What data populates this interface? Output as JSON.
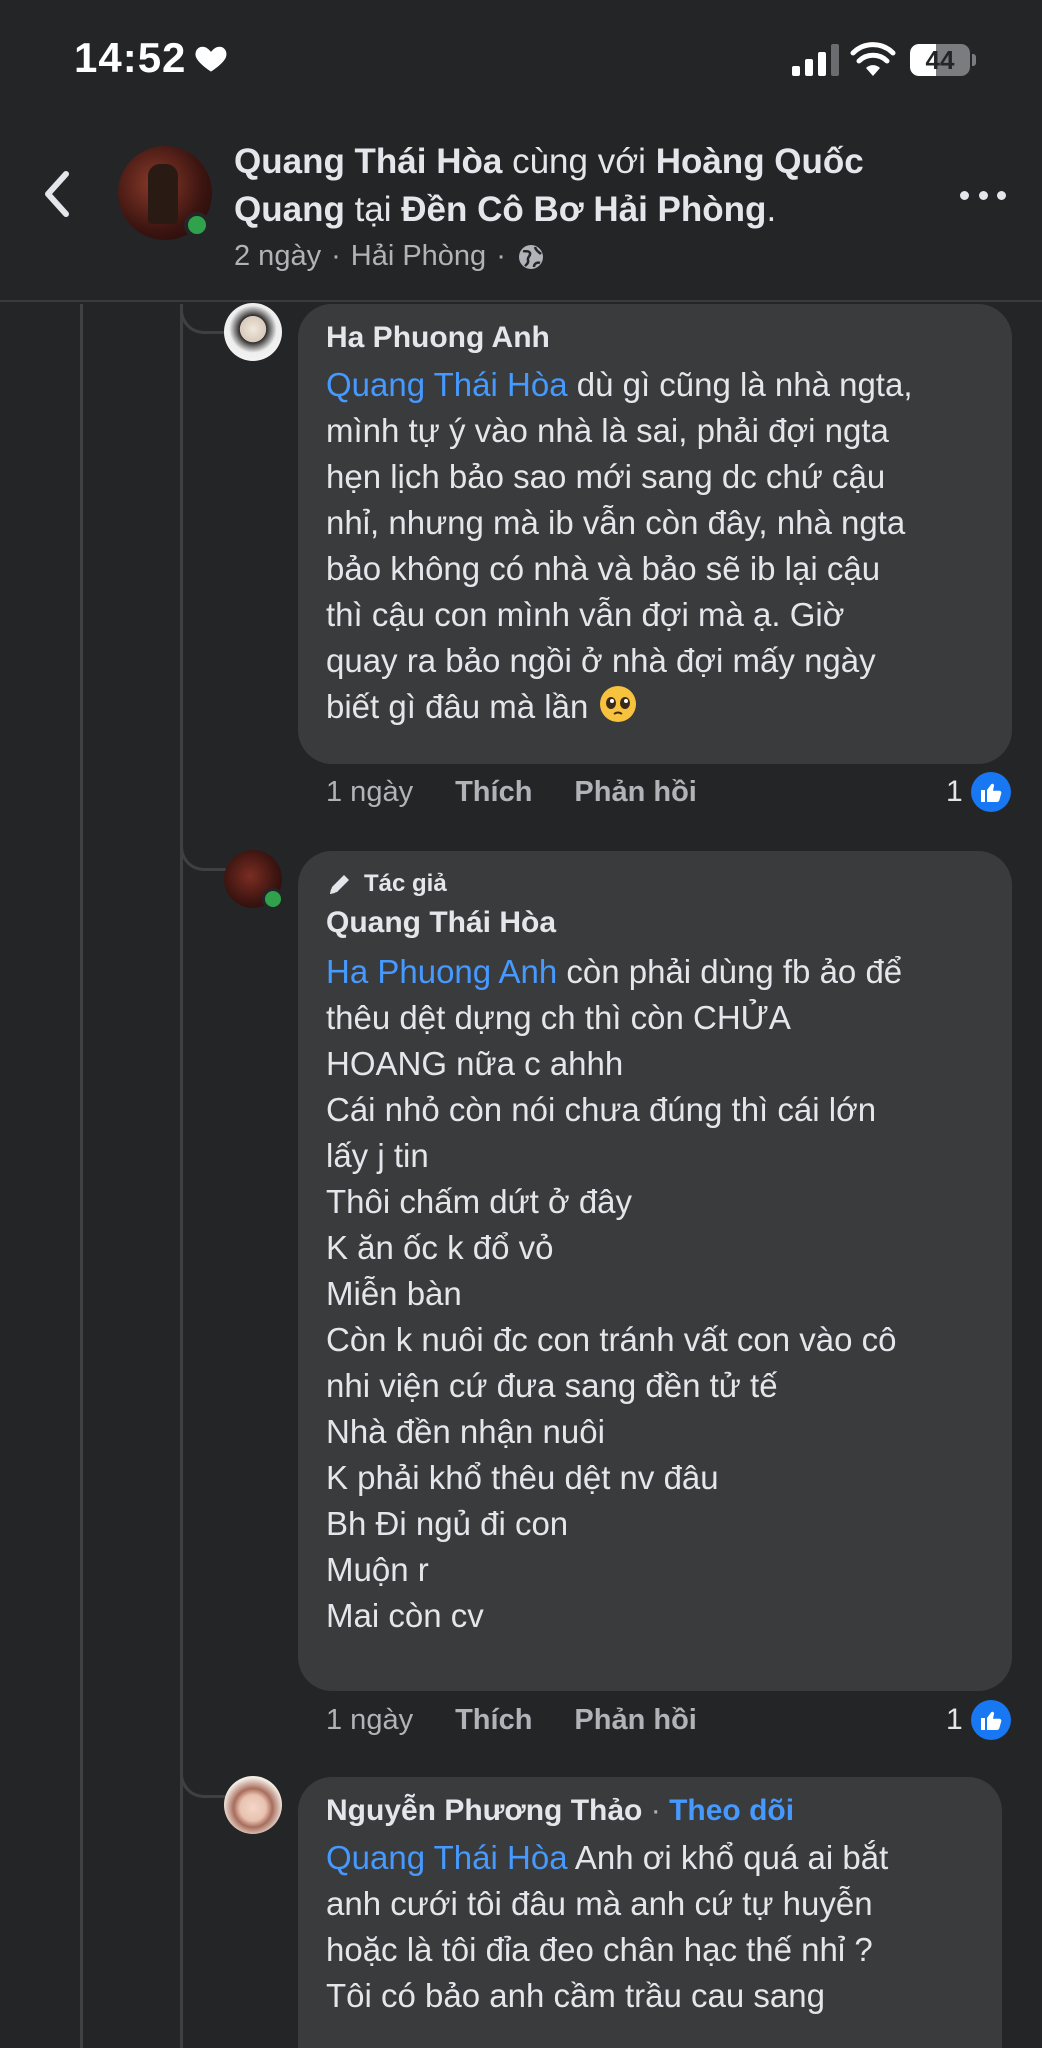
{
  "status_bar": {
    "time": "14:52",
    "battery": "44",
    "battery_level": 0.44,
    "icons": [
      "heart-icon",
      "signal-icon",
      "wifi-icon",
      "battery-icon"
    ]
  },
  "header": {
    "author": "Quang Thái Hòa",
    "with_text": "cùng với",
    "tagged": "Hoàng Quốc Quang",
    "at_text": "tại",
    "place": "Đền Cô Bơ Hải Phòng",
    "period": ".",
    "time_ago": "2 ngày",
    "separator": "·",
    "location": "Hải Phòng",
    "separator2": "·"
  },
  "comments": [
    {
      "author": "Ha Phuong Anh",
      "mention": "Quang Thái Hòa",
      "text": " dù gì cũng là nhà ngta,\nmình tự ý vào nhà là sai, phải đợi ngta\nhẹn lịch bảo sao mới sang dc chứ cậu\nnhỉ, nhưng mà ib vẫn còn đây, nhà ngta\nbảo không có nhà và bảo sẽ ib lại cậu\nthì cậu con mình vẫn đợi mà ạ. Giờ\nquay ra bảo ngồi ở nhà đợi mấy ngày\nbiết gì đâu mà lần ",
      "time_ago": "1 ngày",
      "like_label": "Thích",
      "reply_label": "Phản hồi",
      "reaction_count": "1"
    },
    {
      "badge": "Tác giả",
      "author": "Quang Thái Hòa",
      "mention": "Ha Phuong Anh",
      "text": " còn phải dùng fb ảo để\nthêu dệt dựng ch thì còn CHỬA\nHOANG nữa c ahhh\nCái nhỏ còn nói chưa đúng thì cái lớn\nlấy j tin\nThôi chấm dứt ở đây\nK ăn ốc k đổ vỏ\nMiễn bàn\nCòn k nuôi đc con tránh vất con vào cô\nnhi viện cứ đưa sang đền tử tế\nNhà đền nhận nuôi\nK phải khổ thêu dệt nv đâu\nBh Đi ngủ đi con\nMuộn r\nMai còn cv",
      "time_ago": "1 ngày",
      "like_label": "Thích",
      "reply_label": "Phản hồi",
      "reaction_count": "1"
    },
    {
      "author": "Nguyễn Phương Thảo",
      "separator": "·",
      "follow_label": "Theo dõi",
      "mention": "Quang Thái Hòa",
      "text": " Anh ơi khổ quá ai bắt\nanh cưới tôi đâu mà anh cứ tự huyễn\nhoặc là tôi đỉa đeo chân hạc thế nhỉ ?\nTôi có bảo anh cầm trầu cau sang"
    }
  ],
  "colors": {
    "background": "#242526",
    "bubble": "#3a3b3c",
    "mention": "#4599ff",
    "online": "#31a24c",
    "like": "#1877f2"
  }
}
